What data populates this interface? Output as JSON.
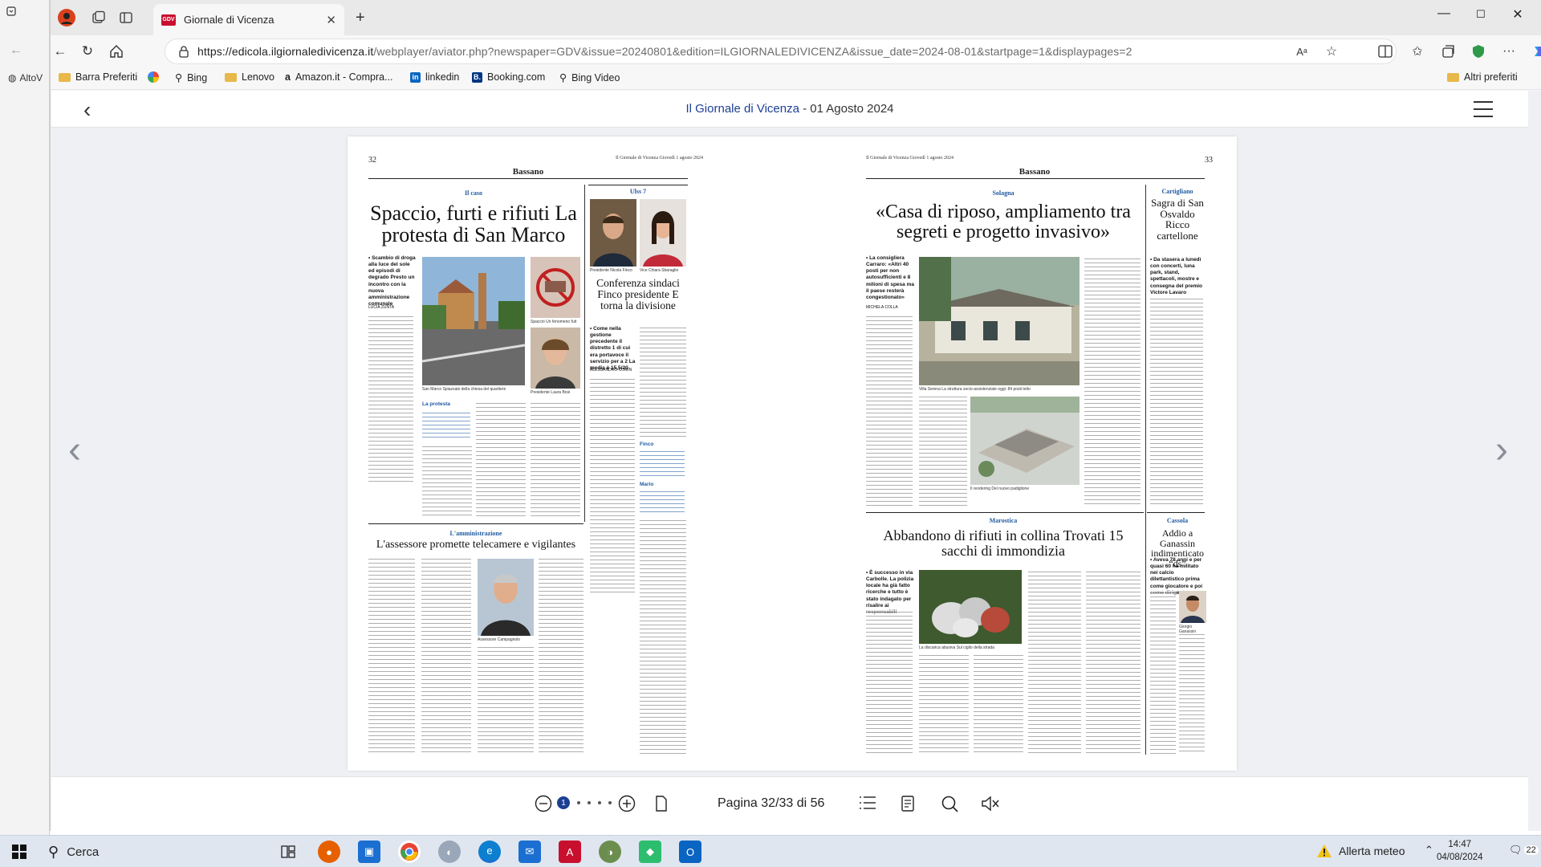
{
  "tab": {
    "favicon_text": "GDV",
    "title": "Giornale di Vicenza"
  },
  "address": {
    "host": "https://edicola.ilgiornaledivicenza.it",
    "path": "/webplayer/aviator.php?newspaper=GDV&issue=20240801&edition=ILGIORNALEDIVICENZA&issue_date=2024-08-01&startpage=1&displaypages=2"
  },
  "background_window": {
    "label": "AltoV"
  },
  "favorites": [
    "Barra Preferiti",
    "",
    "Bing",
    "Lenovo",
    "Amazon.it - Compra...",
    "linkedin",
    "Booking.com",
    "Bing Video"
  ],
  "favorites_other": "Altri preferiti",
  "viewer": {
    "paper_name": "Il Giornale di Vicenza",
    "date": " - 01 Agosto 2024",
    "pager": "Pagina 32/33 di 56",
    "zoom_level": "1"
  },
  "left_page": {
    "number": "32",
    "dateline": "Il Giornale di Vicenza  Giovedì 1 agosto 2024",
    "section": "Bassano",
    "main_kicker": "Il caso",
    "main_headline": "Spaccio, furti e rifiuti La protesta di San Marco",
    "main_sub": "• Scambio di droga alla luce del sole ed episodi di degrado Presto un incontro con la nuova amministrazione comunale",
    "main_byline": "LUCIA ZUNTA",
    "photo1_cap": "San Marco  Spiazzale della chiesa del quartiere",
    "photo2_cap": "Spaccio  Un fenomeno fuit",
    "photo3_cap": "Presidente  Laura Bosi",
    "quote_label": "La protesta",
    "side_kicker": "Ulss 7",
    "side_cap1": "Presidente  Nicola Finco",
    "side_cap2": "Vice  Chiara Sbaraglio",
    "side_headline": "Conferenza sindaci Finco presidente E torna la divisione",
    "side_sub": "• Come nella gestione precedente il distretto 1 di cui era portavoce il servizio per a 2 La media è 15,5/20",
    "side_byline": "ALESSANDRO COMIN",
    "side_box1": "Finco",
    "side_box2": "Mario",
    "bottom_kicker": "L'amministrazione",
    "bottom_headline": "L'assessore promette telecamere e vigilantes",
    "bottom_cap": "Assessore  Campagnolo"
  },
  "right_page": {
    "number": "33",
    "dateline": "Il Giornale di Vicenza  Giovedì 1 agosto 2024",
    "section": "Bassano",
    "main_kicker": "Solagna",
    "main_headline": "«Casa di riposo, ampliamento tra segreti e progetto invasivo»",
    "main_sub": "• La consigliera Carraro: «Altri 40 posti per non autosufficienti e 8 milioni di spesa ma il paese resterà congestionato»",
    "main_byline": "MICHELA COLLA",
    "photo1_cap": "Villa Serena  La struttura socio-assistenziale oggi: 84 posti letto",
    "photo2_cap": "Il rendering  Del nuovo padiglione",
    "side_kicker": "Cartigliano",
    "side_headline": "Sagra di San Osvaldo Ricco cartellone",
    "side_sub": "• Da stasera a lunedì con concerti, luna park, stand, spettacoli, mostre e consegna del premio Victore Lavaro",
    "mid_kicker": "Marostica",
    "mid_headline": "Abbandono di rifiuti in collina Trovati 15 sacchi di immondizia",
    "mid_sub": "• È successo in via Carbolle. La polizia locale ha già fatto ricerche e tutto è stato indagato per risalire ai responsabili",
    "mid_cap": "La discarica abusiva  Sul ciglio della strada",
    "br_kicker": "Cassola",
    "br_headline": "Addio a Ganassin indimenticato “ds”",
    "br_sub": "• Aveva 78 anni e per quasi 60 ha militato nei calcio dilettantistico prima come giocatore e poi come dirigente",
    "br_cap": "Giorgio Ganassin"
  },
  "taskbar": {
    "search_placeholder": "Cerca",
    "weather": "Allerta meteo",
    "time": "14:47",
    "date": "04/08/2024",
    "badge": "22"
  }
}
